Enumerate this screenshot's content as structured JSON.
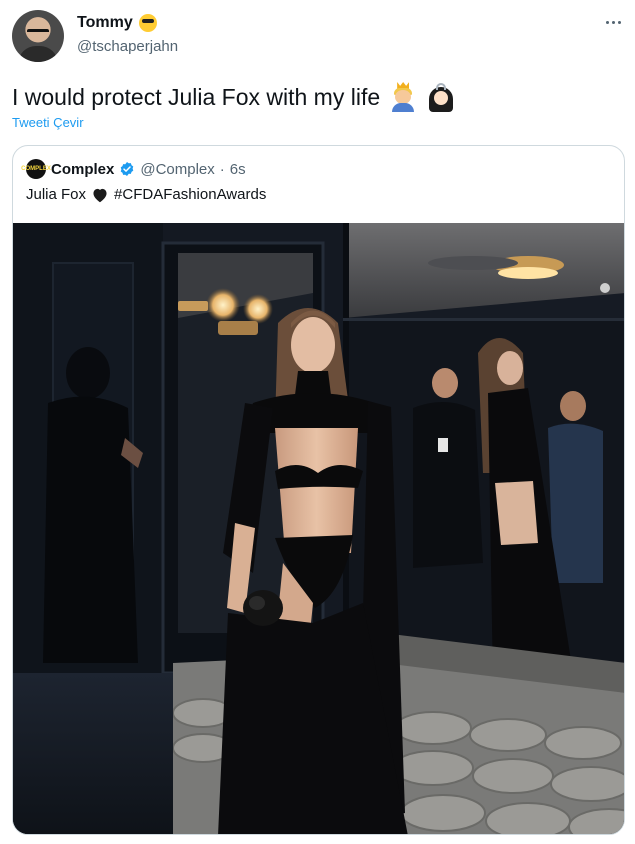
{
  "author": {
    "display_name": "Tommy",
    "handle": "@tschaperjahn",
    "emoji": "smiling-face-with-sunglasses"
  },
  "tweet": {
    "text": "I would protect Julia Fox with my life",
    "emojis": [
      "prince",
      "princess"
    ],
    "translate_label": "Tweeti Çevir"
  },
  "quoted": {
    "logo_text": "COMPLEX",
    "name": "Complex",
    "verified": true,
    "handle": "@Complex",
    "separator": "·",
    "time": "6s",
    "text": "Julia Fox",
    "heart": "black-heart",
    "hashtag": "#CFDAFashionAwards",
    "photo_subject": "woman in black cutout gown posing beside mirror"
  },
  "colors": {
    "text": "#0f1419",
    "secondary": "#536471",
    "link": "#1d9bf0",
    "border": "#cfd9de"
  }
}
